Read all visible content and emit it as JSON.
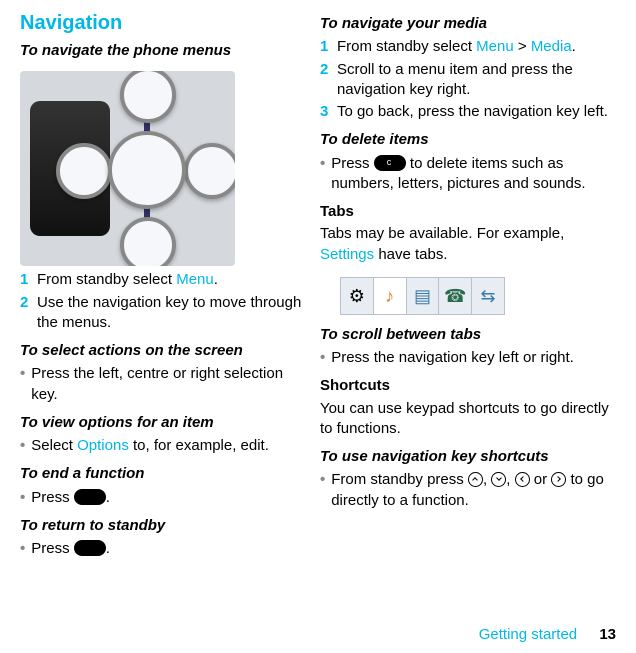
{
  "left": {
    "title": "Navigation",
    "sub1": "To navigate the phone menus",
    "s1n": "1",
    "s1a": "From standby select ",
    "s1link": "Menu",
    "s1b": ".",
    "s2n": "2",
    "s2": "Use the navigation key to move through the menus.",
    "sub2": "To select actions on the screen",
    "b1": "Press the left, centre or right selection key.",
    "sub3": "To view options for an item",
    "b2a": "Select ",
    "b2link": "Options",
    "b2b": " to, for example, edit.",
    "sub4": "To end a function",
    "b3a": "Press ",
    "b3b": ".",
    "sub5": "To return to standby",
    "b4a": "Press ",
    "b4b": "."
  },
  "right": {
    "sub1": "To navigate your media",
    "s1n": "1",
    "s1a": "From standby select ",
    "s1link1": "Menu",
    "s1gt": " > ",
    "s1link2": "Media",
    "s1b": ".",
    "s2n": "2",
    "s2": "Scroll to a menu item and press the navigation key right.",
    "s3n": "3",
    "s3": "To go back, press the navigation key left.",
    "sub2": "To delete items",
    "b1a": "Press ",
    "b1b": " to delete items such as numbers, letters, pictures and sounds.",
    "tabsHeading": "Tabs",
    "tabsPara1": "Tabs may be available. For example, ",
    "tabsLink": "Settings",
    "tabsPara2": " have tabs.",
    "sub3": "To scroll between tabs",
    "b2": "Press the navigation key left or right.",
    "shortcutsHeading": "Shortcuts",
    "shortcutsPara": "You can use keypad shortcuts to go directly to functions.",
    "sub4": "To use navigation key shortcuts",
    "b3a": "From standby press ",
    "b3comma1": ", ",
    "b3comma2": ", ",
    "b3or": " or ",
    "b3b": " to go directly to a function."
  },
  "footer": {
    "section": "Getting started",
    "page": "13"
  }
}
